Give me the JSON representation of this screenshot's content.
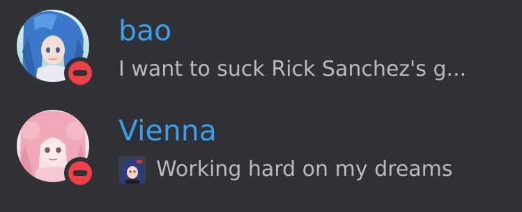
{
  "members": [
    {
      "username": "bao",
      "status_text": "I want to suck Rick Sanchez's g...",
      "presence": "do-not-disturb",
      "username_color": "#3f9ee8",
      "presence_color": "#ed4245",
      "avatar_icon": "anime-blue-hair-avatar",
      "has_status_emoji": false
    },
    {
      "username": "Vienna",
      "status_text": "Working hard on my dreams",
      "presence": "do-not-disturb",
      "username_color": "#3f9ee8",
      "presence_color": "#ed4245",
      "avatar_icon": "anime-pink-hair-avatar",
      "has_status_emoji": true,
      "status_emoji_icon": "anime-character-emoji"
    }
  ]
}
